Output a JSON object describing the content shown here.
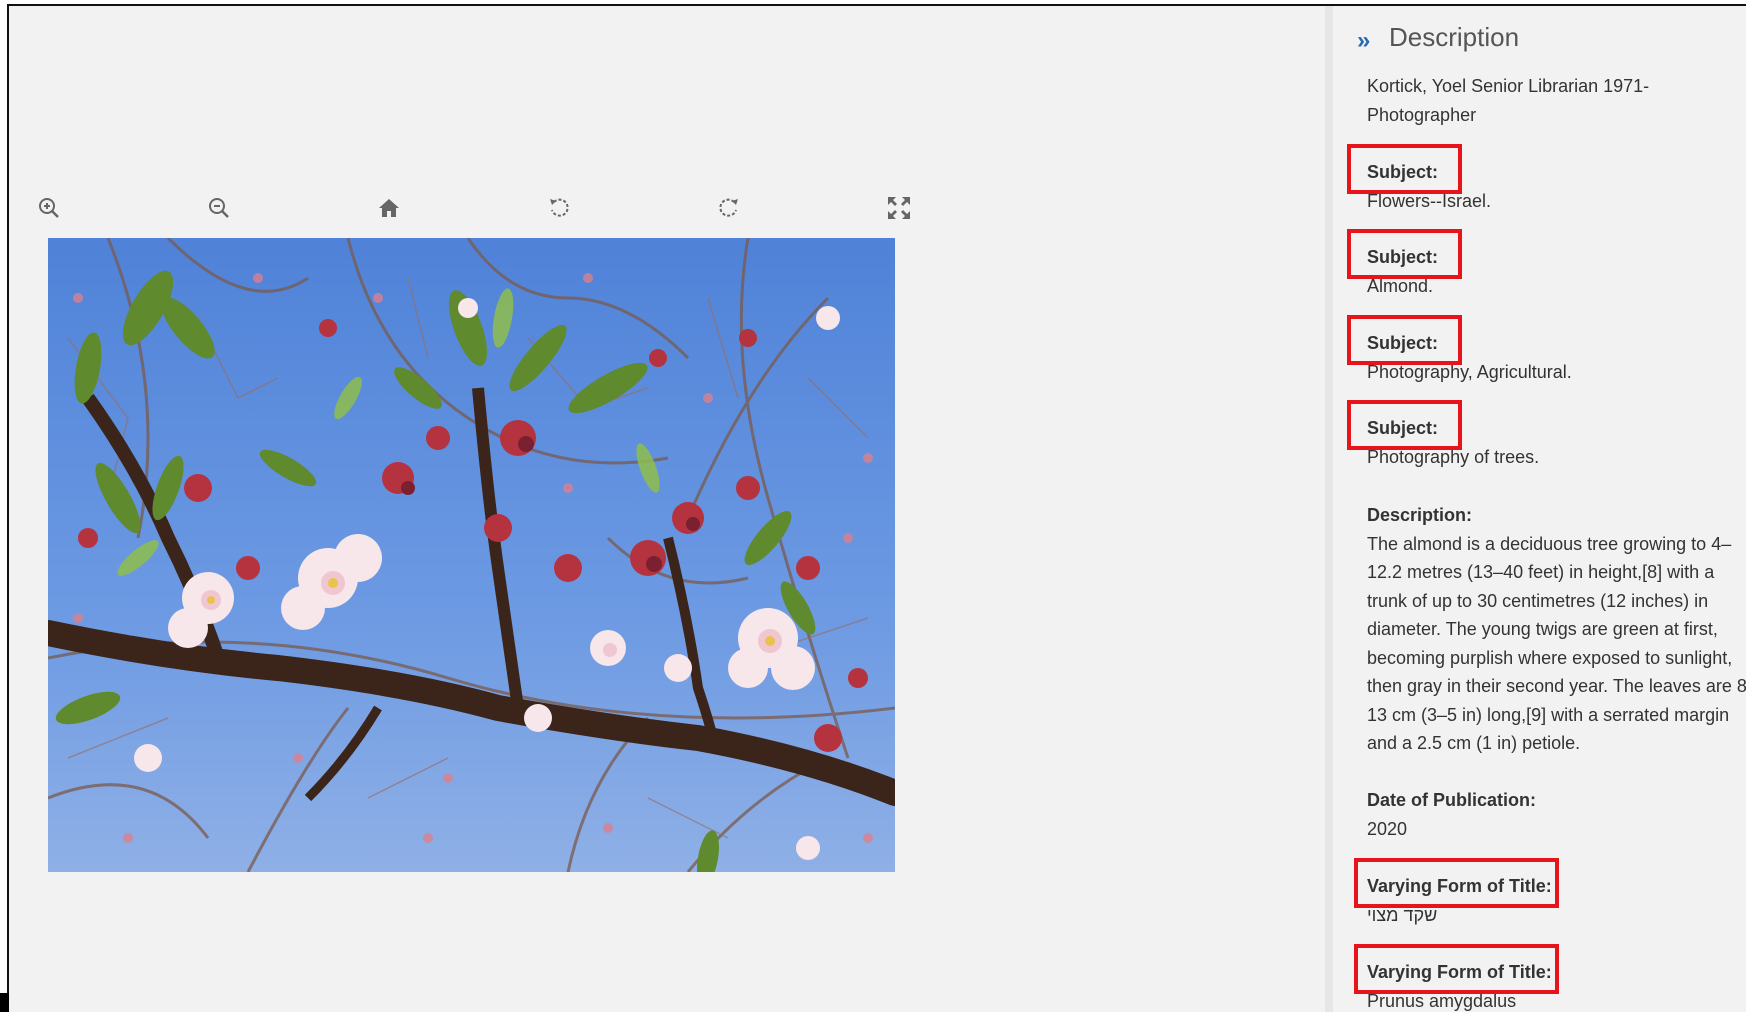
{
  "toolbar": {
    "zoom_in": "zoom-in-icon",
    "zoom_out": "zoom-out-icon",
    "home": "home-icon",
    "rotate_left": "rotate-left-icon",
    "rotate_right": "rotate-right-icon",
    "fullscreen": "fullscreen-icon"
  },
  "image": {
    "subject": "almond-blossom-photo"
  },
  "panel": {
    "title": "Description",
    "creator_line1": "Kortick, Yoel Senior Librarian 1971-",
    "creator_line2": "Photographer",
    "subjects": [
      {
        "label": "Subject:",
        "value": "Flowers--Israel."
      },
      {
        "label": "Subject:",
        "value": "Almond."
      },
      {
        "label": "Subject:",
        "value": "Photography, Agricultural."
      },
      {
        "label": "Subject:",
        "value": "Photography of trees."
      }
    ],
    "description": {
      "label": "Description:",
      "value": "The almond is a deciduous tree growing to 4–12.2 metres (13–40 feet) in height,[8] with a trunk of up to 30 centimetres (12 inches) in diameter. The young twigs are green at first, becoming purplish where exposed to sunlight, then gray in their second year. The leaves are 8–13 cm (3–5 in) long,[9] with a serrated margin and a 2.5 cm (1 in) petiole."
    },
    "date": {
      "label": "Date of Publication:",
      "value": "2020"
    },
    "varying_titles": [
      {
        "label": "Varying Form of Title:",
        "value": "שקד מצוי"
      },
      {
        "label": "Varying Form of Title:",
        "value": "Prunus amygdalus"
      }
    ]
  },
  "colors": {
    "highlight": "#e8141b",
    "accent": "#2a6cb2",
    "background": "#f2f2f2"
  }
}
